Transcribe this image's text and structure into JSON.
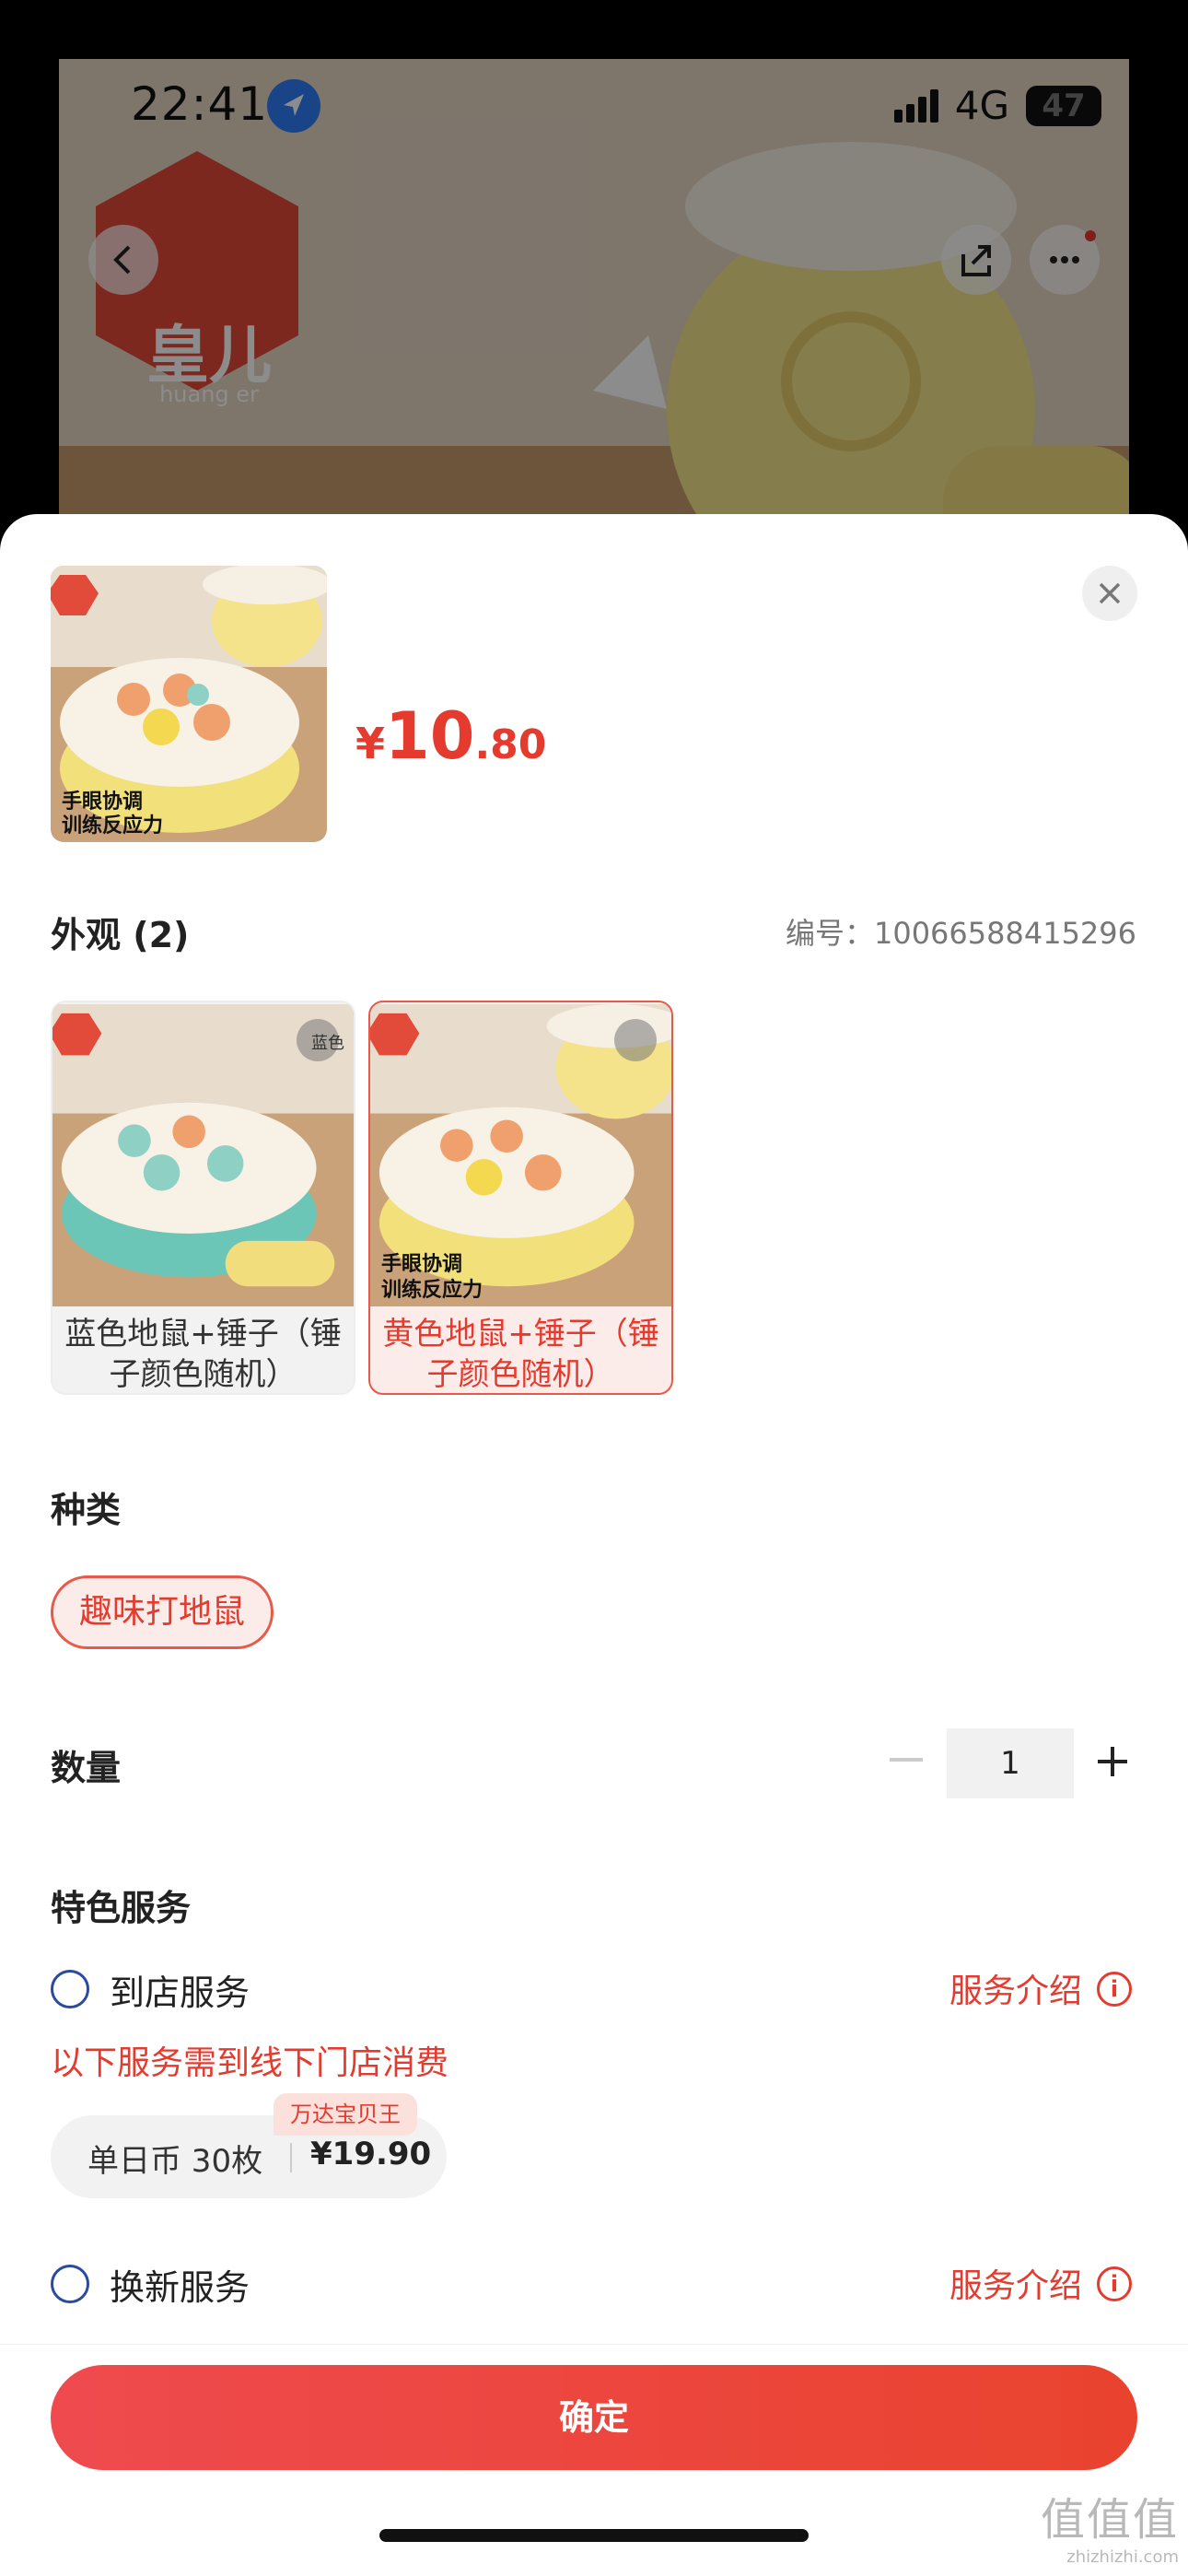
{
  "status_bar": {
    "time": "22:41",
    "network": "4G",
    "battery": "47"
  },
  "background": {
    "brand_logo_text": "皇儿",
    "brand_logo_sub": "huang er"
  },
  "sheet": {
    "price": {
      "currency": "¥",
      "integer": "10",
      "decimal": ".80"
    },
    "appearance": {
      "title": "外观 (2)",
      "code_label": "编号：",
      "code_value": "10066588415296",
      "variants": [
        {
          "label": "蓝色地鼠+锤子（锤子颜色随机）",
          "corner_tag": "蓝色",
          "selected": false
        },
        {
          "label": "黄色地鼠+锤子（锤子颜色随机）",
          "overlay_text_1": "手眼协调",
          "overlay_text_2": "训练反应力",
          "selected": true
        }
      ]
    },
    "main_thumb": {
      "overlay_text_1": "手眼协调",
      "overlay_text_2": "训练反应力"
    },
    "kind": {
      "title": "种类",
      "option": "趣味打地鼠"
    },
    "quantity": {
      "title": "数量",
      "value": "1"
    },
    "services": {
      "title": "特色服务",
      "store": {
        "name": "到店服务",
        "intro": "服务介绍",
        "note": "以下服务需到线下门店消费"
      },
      "package": {
        "tag": "万达宝贝王",
        "name": "单日币 30枚",
        "price": "¥19.90"
      },
      "renew": {
        "name": "换新服务",
        "intro": "服务介绍"
      }
    },
    "confirm_label": "确定"
  },
  "watermark": {
    "main": "值值值",
    "sub": "zhizhizhi.com"
  },
  "colors": {
    "accent": "#e53b2f",
    "accent_bg": "#fcece9",
    "button_start": "#ef4a4e",
    "button_end": "#e9432f"
  }
}
